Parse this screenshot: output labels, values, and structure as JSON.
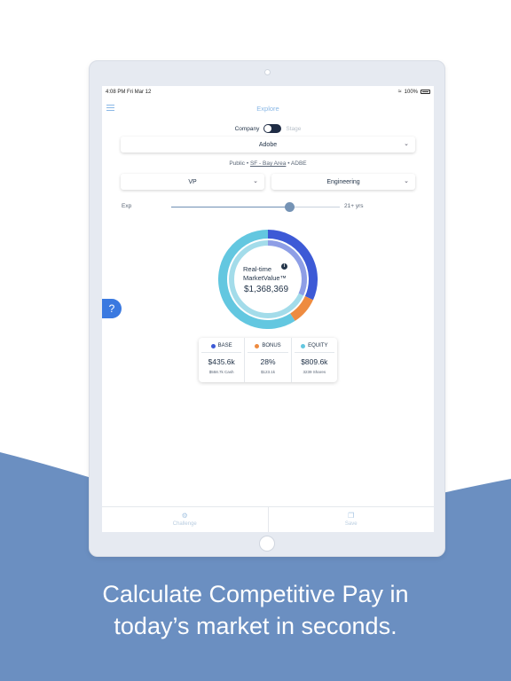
{
  "colors": {
    "wave": "#6b8fc1",
    "base": "#3d5ad6",
    "bonus": "#ee8b40",
    "equity": "#63c7e0",
    "accent": "#8ab8e6",
    "help_button": "#3a79e0",
    "toggle": "#1f2c45"
  },
  "status_bar": {
    "time": "4:08 PM   Fri Mar 12",
    "battery": "100%"
  },
  "nav": {
    "title": "Explore",
    "menu_icon": "hamburger-menu-icon"
  },
  "toggle": {
    "left_label": "Company",
    "right_label": "Stage",
    "selected": "Company"
  },
  "company_select": {
    "value": "Adobe"
  },
  "company_meta": {
    "prefix": "Public • ",
    "location": "SF - Bay Area",
    "suffix": " • ADBE"
  },
  "level_select": {
    "value": "VP"
  },
  "department_select": {
    "value": "Engineering"
  },
  "experience": {
    "label": "Exp",
    "max_label": "21+ yrs",
    "slider_fraction": 0.7
  },
  "market_value": {
    "title_line1": "Real-time",
    "title_line2": "MarketValue™",
    "info_icon": "i",
    "total": "$1,368,369",
    "segments": [
      {
        "name": "BASE",
        "fraction": 0.318,
        "color": "#3d5ad6"
      },
      {
        "name": "BONUS",
        "fraction": 0.09,
        "color": "#ee8b40"
      },
      {
        "name": "EQUITY",
        "fraction": 0.592,
        "color": "#63c7e0"
      }
    ]
  },
  "help_button": {
    "label": "?"
  },
  "compensation": [
    {
      "label": "BASE",
      "color": "#3d5ad6",
      "value": "$435.6k",
      "detail": "$558.7k Cash"
    },
    {
      "label": "BONUS",
      "color": "#ee8b40",
      "value": "28%",
      "detail": "$123.1k"
    },
    {
      "label": "EQUITY",
      "color": "#63c7e0",
      "value": "$809.6k",
      "detail": "3239 Shares"
    }
  ],
  "tabs": [
    {
      "label": "Challenge",
      "icon": "challenge-icon"
    },
    {
      "label": "Save",
      "icon": "save-icon"
    }
  ],
  "headline": {
    "line1": "Calculate Competitive Pay in",
    "line2": "today’s market in seconds."
  }
}
